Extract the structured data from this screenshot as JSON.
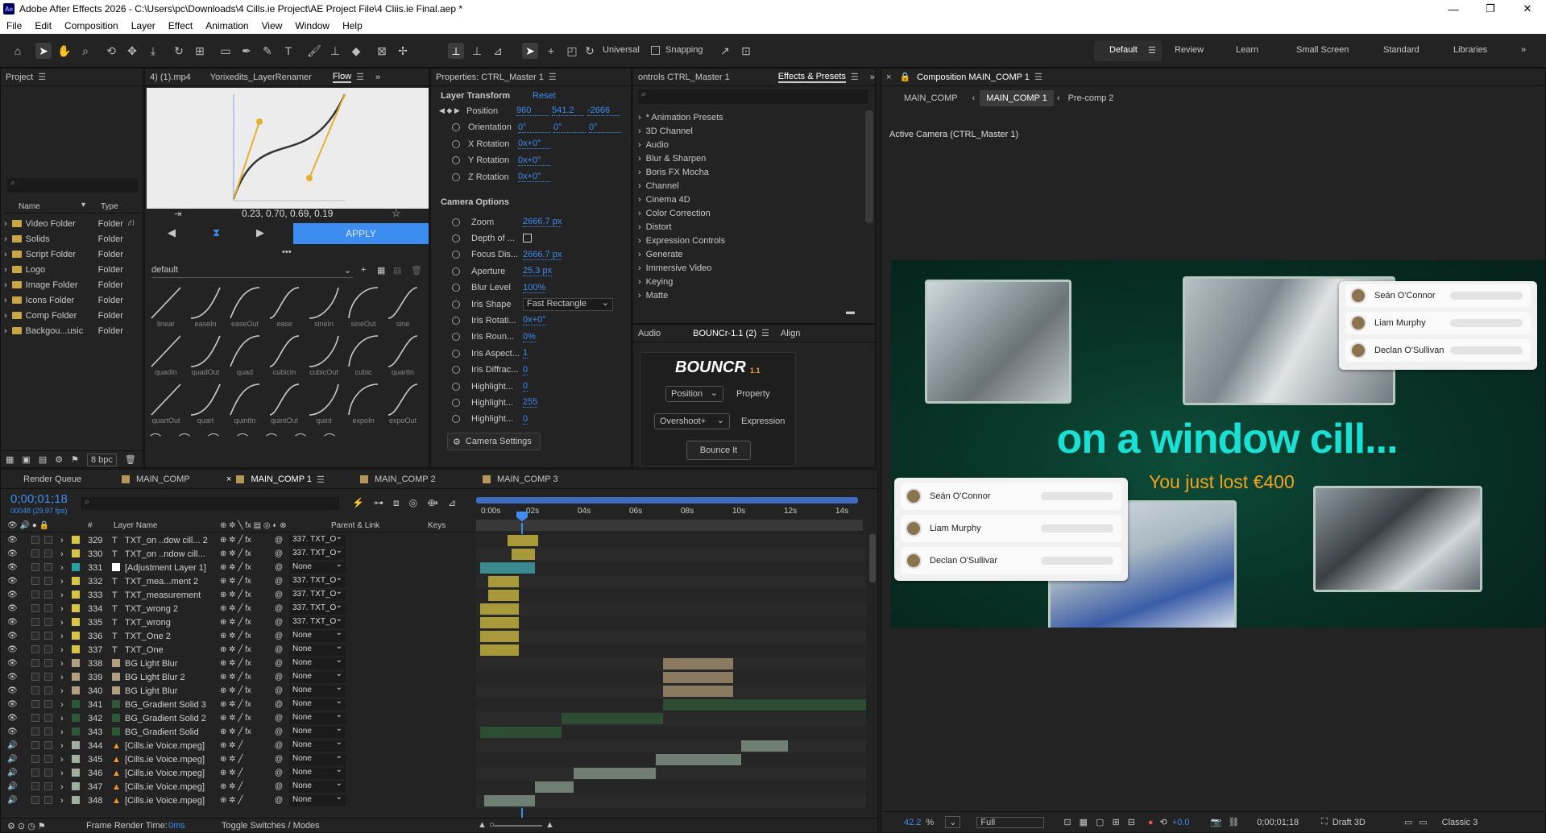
{
  "app": {
    "title": "Adobe After Effects 2026 - C:\\Users\\pc\\Downloads\\4 Cills.ie Project\\AE Project File\\4 Cliis.ie Final.aep *",
    "icon_label": "Ae"
  },
  "menu": [
    "File",
    "Edit",
    "Composition",
    "Layer",
    "Effect",
    "Animation",
    "View",
    "Window",
    "Help"
  ],
  "toolbar": {
    "universal": "Universal",
    "snapping": "Snapping"
  },
  "workspaces": [
    "Default",
    "Review",
    "Learn",
    "Small Screen",
    "Standard",
    "Libraries"
  ],
  "project": {
    "title": "Project",
    "col_name": "Name",
    "col_type": "Type",
    "bpc": "8 bpc",
    "items": [
      {
        "name": "Video Folder",
        "type": "Folder"
      },
      {
        "name": "Solids",
        "type": "Folder"
      },
      {
        "name": "Script Folder",
        "type": "Folder"
      },
      {
        "name": "Logo",
        "type": "Folder"
      },
      {
        "name": "Image Folder",
        "type": "Folder"
      },
      {
        "name": "Icons Folder",
        "type": "Folder"
      },
      {
        "name": "Comp Folder",
        "type": "Folder"
      },
      {
        "name": "Backgou...usic",
        "type": "Folder"
      }
    ]
  },
  "flow": {
    "tabs": [
      "4) (1).mp4",
      "Yorixedits_LayerRenamer",
      "Flow"
    ],
    "values": "0.23, 0.70, 0.69, 0.19",
    "apply": "APPLY",
    "preset": "default",
    "eases": [
      "linear",
      "easeIn",
      "easeOut",
      "ease",
      "sineIn",
      "sineOut",
      "sine",
      "quadIn",
      "quadOut",
      "quad",
      "cubicIn",
      "cubicOut",
      "cubic",
      "quartIn",
      "quartOut",
      "quart",
      "quintIn",
      "quintOut",
      "quint",
      "expoIn",
      "expoOut"
    ]
  },
  "properties": {
    "title": "Properties: CTRL_Master 1",
    "section1": "Layer Transform",
    "reset": "Reset",
    "position": {
      "label": "Position",
      "x": "960",
      "y": "541.2",
      "z": "-2666"
    },
    "orientation": {
      "label": "Orientation",
      "x": "0°",
      "y": "0°",
      "z": "0°"
    },
    "xrot": {
      "label": "X Rotation",
      "v": "0x+0°"
    },
    "yrot": {
      "label": "Y Rotation",
      "v": "0x+0°"
    },
    "zrot": {
      "label": "Z Rotation",
      "v": "0x+0°"
    },
    "section2": "Camera Options",
    "cam": [
      {
        "label": "Zoom",
        "v": "2666.7 px"
      },
      {
        "label": "Depth of ...",
        "v": ""
      },
      {
        "label": "Focus Dis...",
        "v": "2666.7 px"
      },
      {
        "label": "Aperture",
        "v": "25.3 px"
      },
      {
        "label": "Blur Level",
        "v": "100%"
      },
      {
        "label": "Iris Shape",
        "v": "Fast Rectangle"
      },
      {
        "label": "Iris Rotati...",
        "v": "0x+0°"
      },
      {
        "label": "Iris Roun...",
        "v": "0%"
      },
      {
        "label": "Iris Aspect...",
        "v": "1"
      },
      {
        "label": "Iris Diffrac...",
        "v": "0"
      },
      {
        "label": "Highlight...",
        "v": "0"
      },
      {
        "label": "Highlight...",
        "v": "255"
      },
      {
        "label": "Highlight...",
        "v": "0"
      }
    ],
    "camera_settings": "Camera Settings"
  },
  "effects": {
    "tab_left": "ontrols CTRL_Master 1",
    "title": "Effects & Presets",
    "items": [
      "* Animation Presets",
      "3D Channel",
      "Audio",
      "Blur & Sharpen",
      "Boris FX Mocha",
      "Channel",
      "Cinema 4D",
      "Color Correction",
      "Distort",
      "Expression Controls",
      "Generate",
      "Immersive Video",
      "Keying",
      "Matte"
    ]
  },
  "bouncr": {
    "tabs": [
      "Audio",
      "BOUNCr-1.1 (2)",
      "Align"
    ],
    "logo": "BOUNCR",
    "version": "1.1",
    "property_sel": "Position",
    "property_lbl": "Property",
    "expr_sel": "Overshoot+",
    "expr_lbl": "Expression",
    "button": "Bounce It"
  },
  "composition": {
    "title": "Composition MAIN_COMP 1",
    "breadcrumbs": [
      "MAIN_COMP",
      "MAIN_COMP 1",
      "Pre-comp 2"
    ],
    "camera": "Active Camera (CTRL_Master 1)",
    "headline": "on a window cill...",
    "subline": "You just lost €400",
    "card1": [
      "Seán O'Connor",
      "Liam Murphy",
      "Declan O'Sullivan"
    ],
    "card2": [
      "Seán O'Connor",
      "Liam Murphy",
      "Declan O'Sullivar"
    ],
    "zoom": "42.2",
    "resolution": "Full",
    "exposure": "+0.0",
    "timecode": "0;00;01;18",
    "renderer": "Draft 3D",
    "mode": "Classic 3"
  },
  "timeline": {
    "tabs": [
      "Render Queue",
      "MAIN_COMP",
      "MAIN_COMP 1",
      "MAIN_COMP 2",
      "MAIN_COMP 3"
    ],
    "timecode": "0;00;01;18",
    "fps": "00048 (29.97 fps)",
    "col_layer": "Layer Name",
    "col_parent": "Parent & Link",
    "col_keys": "Keys",
    "ruler": [
      "0:00s",
      "02s",
      "04s",
      "06s",
      "08s",
      "10s",
      "12s",
      "14s"
    ],
    "layers": [
      {
        "num": "329",
        "type": "T",
        "name": "TXT_on ..dow cill... 2",
        "parent": "337. TXT_O",
        "color": "#d8c445",
        "bar": [
          0.08,
          0.16
        ],
        "barc": "#a89a3b"
      },
      {
        "num": "330",
        "type": "T",
        "name": "TXT_on ..ndow cill...",
        "parent": "337. TXT_O",
        "color": "#d8c445",
        "bar": [
          0.09,
          0.15
        ],
        "barc": "#a89a3b"
      },
      {
        "num": "331",
        "type": "",
        "name": "[Adjustment Layer 1]",
        "parent": "None",
        "color": "#29a0a0",
        "bar": [
          0.01,
          0.15
        ],
        "barc": "#3b8a8f"
      },
      {
        "num": "332",
        "type": "T",
        "name": "TXT_mea...ment 2",
        "parent": "337. TXT_O",
        "color": "#d8c445",
        "bar": [
          0.03,
          0.11
        ],
        "barc": "#a89a3b"
      },
      {
        "num": "333",
        "type": "T",
        "name": "TXT_measurement",
        "parent": "337. TXT_O",
        "color": "#d8c445",
        "bar": [
          0.03,
          0.11
        ],
        "barc": "#a89a3b"
      },
      {
        "num": "334",
        "type": "T",
        "name": "TXT_wrong 2",
        "parent": "337. TXT_O",
        "color": "#d8c445",
        "bar": [
          0.01,
          0.11
        ],
        "barc": "#a89a3b"
      },
      {
        "num": "335",
        "type": "T",
        "name": "TXT_wrong",
        "parent": "337. TXT_O",
        "color": "#d8c445",
        "bar": [
          0.01,
          0.11
        ],
        "barc": "#a89a3b"
      },
      {
        "num": "336",
        "type": "T",
        "name": "TXT_One 2",
        "parent": "None",
        "color": "#d8c445",
        "bar": [
          0.01,
          0.11
        ],
        "barc": "#a89a3b"
      },
      {
        "num": "337",
        "type": "T",
        "name": "TXT_One",
        "parent": "None",
        "color": "#d8c445",
        "bar": [
          0.01,
          0.11
        ],
        "barc": "#a89a3b"
      },
      {
        "num": "338",
        "type": "",
        "name": "BG Light Blur",
        "parent": "None",
        "color": "#b0a080",
        "bar": [
          0.48,
          0.66
        ],
        "barc": "#8a7a60"
      },
      {
        "num": "339",
        "type": "",
        "name": "BG Light Blur 2",
        "parent": "None",
        "color": "#b0a080",
        "bar": [
          0.48,
          0.66
        ],
        "barc": "#8a7a60"
      },
      {
        "num": "340",
        "type": "",
        "name": "BG Light Blur",
        "parent": "None",
        "color": "#b0a080",
        "bar": [
          0.48,
          0.66
        ],
        "barc": "#8a7a60"
      },
      {
        "num": "341",
        "type": "",
        "name": "BG_Gradient Solid 3",
        "parent": "None",
        "color": "#2d5a36",
        "bar": [
          0.48,
          1.0
        ],
        "barc": "#2d4d33"
      },
      {
        "num": "342",
        "type": "",
        "name": "BG_Gradient Solid 2",
        "parent": "None",
        "color": "#2d5a36",
        "bar": [
          0.22,
          0.48
        ],
        "barc": "#2d4d33"
      },
      {
        "num": "343",
        "type": "",
        "name": "BG_Gradient Solid",
        "parent": "None",
        "color": "#2d5a36",
        "bar": [
          0.01,
          0.22
        ],
        "barc": "#2d4d33"
      },
      {
        "num": "344",
        "type": "A",
        "name": "[Cills.ie Voice.mpeg]",
        "parent": "None",
        "color": "#a0b0a0",
        "bar": [
          0.68,
          0.8
        ],
        "barc": "#6f7f74"
      },
      {
        "num": "345",
        "type": "A",
        "name": "[Cills.ie Voice.mpeg]",
        "parent": "None",
        "color": "#a0b0a0",
        "bar": [
          0.46,
          0.68
        ],
        "barc": "#6f7f74"
      },
      {
        "num": "346",
        "type": "A",
        "name": "[Cills.ie Voice.mpeg]",
        "parent": "None",
        "color": "#a0b0a0",
        "bar": [
          0.25,
          0.46
        ],
        "barc": "#6f7f74"
      },
      {
        "num": "347",
        "type": "A",
        "name": "[Cills.ie Voice.mpeg]",
        "parent": "None",
        "color": "#a0b0a0",
        "bar": [
          0.15,
          0.25
        ],
        "barc": "#6f7f74"
      },
      {
        "num": "348",
        "type": "A",
        "name": "[Cills.ie Voice.mpeg]",
        "parent": "None",
        "color": "#a0b0a0",
        "bar": [
          0.02,
          0.15
        ],
        "barc": "#6f7f74"
      }
    ],
    "footer_render": "Frame Render Time:",
    "footer_ms": "0ms",
    "footer_toggle": "Toggle Switches / Modes"
  }
}
